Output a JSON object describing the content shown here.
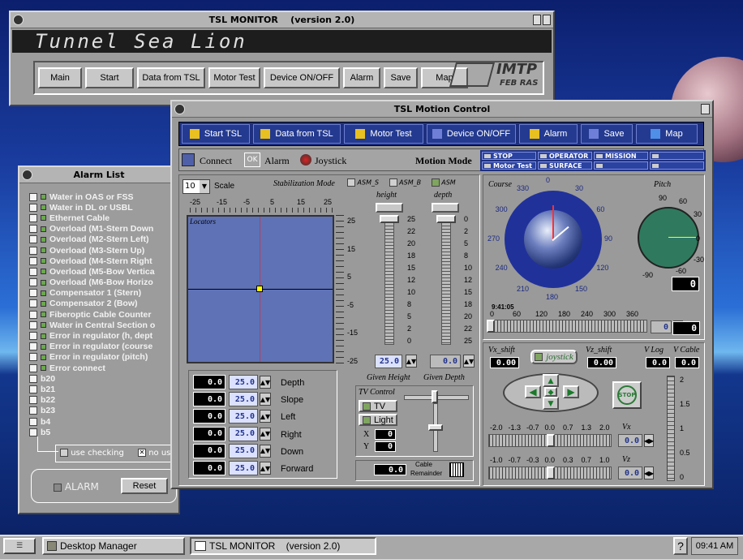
{
  "monitor": {
    "title": "TSL MONITOR    (version 2.0)",
    "app_name": "Tunnel Sea Lion",
    "buttons": [
      "Main",
      "Start",
      "Data from TSL",
      "Motor Test",
      "Device ON/OFF",
      "Alarm",
      "Save",
      "Map"
    ],
    "logo_text": "IMTP",
    "logo_sub": "FEB RAS"
  },
  "alarm": {
    "title": "Alarm List",
    "items": [
      "Water in OAS  or FSS",
      "Water in DL or USBL",
      "Ethernet Cable",
      "Overload (M1-Stern Down",
      "Overload (M2-Stern Left)",
      "Overload (M3-Stern Up)",
      "Overload (M4-Stern Right",
      "Overload (M5-Bow Vertica",
      "Overload (M6-Bow Horizo",
      "Compensator 1 (Stern)",
      "Compensator 2 (Bow)",
      "Fiberoptic Cable Counter",
      "Water in Central Section o",
      "Error in regulator (h, dept",
      "Error in regulator (course",
      "Error in regulator (pitch)",
      "Error connect",
      "b20",
      "b21",
      "b22",
      "b23",
      "b4",
      "b5"
    ],
    "use_checking": "use checking",
    "no_use": "no us",
    "alarm_label": "ALARM",
    "reset": "Reset"
  },
  "motion": {
    "title": "TSL Motion Control",
    "toolbar": [
      "Start TSL",
      "Data from TSL",
      "Motor Test",
      "Device ON/OFF",
      "Alarm",
      "Save",
      "Map"
    ],
    "connect": "Connect",
    "ok": "OK",
    "alarm": "Alarm",
    "joystick": "Joystick",
    "motion_mode": "Motion Mode",
    "modes": [
      "STOP",
      "OPERATOR",
      "MISSION",
      "",
      "Motor Test",
      "SURFACE",
      "",
      ""
    ],
    "scale_val": "10",
    "scale": "Scale",
    "stab_mode": "Stabilization Mode",
    "asm_s": "ASM_S",
    "asm_b": "ASM_B",
    "asm": "ASM",
    "height": "height",
    "depth": "depth",
    "locators": "Locators",
    "x_ticks": [
      "-25",
      "-15",
      "-5",
      "5",
      "15",
      "25"
    ],
    "y_ticks": [
      "25",
      "15",
      "5",
      "-5",
      "-15",
      "-25"
    ],
    "height_ticks": [
      "25",
      "22",
      "20",
      "18",
      "15",
      "12",
      "10",
      "8",
      "5",
      "2",
      "0"
    ],
    "depth_ticks": [
      "0",
      "2",
      "5",
      "8",
      "10",
      "12",
      "15",
      "18",
      "20",
      "22",
      "25"
    ],
    "given_height_val": "25.0",
    "given_depth_val": "0.0",
    "given_height": "Given Height",
    "given_depth": "Given Depth",
    "params": [
      {
        "a": "0.0",
        "b": "25.0",
        "label": "Depth"
      },
      {
        "a": "0.0",
        "b": "25.0",
        "label": "Slope"
      },
      {
        "a": "0.0",
        "b": "25.0",
        "label": "Left"
      },
      {
        "a": "0.0",
        "b": "25.0",
        "label": "Right"
      },
      {
        "a": "0.0",
        "b": "25.0",
        "label": "Down"
      },
      {
        "a": "0.0",
        "b": "25.0",
        "label": "Forward"
      }
    ],
    "tv_control": "TV Control",
    "tv": "TV",
    "light": "Light",
    "x": "X",
    "y": "Y",
    "x_val": "0",
    "y_val": "0",
    "cable_val": "0.0",
    "cable": "Cable",
    "remainder": "Remainder",
    "course": "Course",
    "pitch": "Pitch",
    "course_ticks": [
      "330",
      "0",
      "30",
      "60",
      "90",
      "120",
      "150",
      "180",
      "210",
      "240",
      "270",
      "300"
    ],
    "pitch_ticks": [
      "90",
      "60",
      "30",
      "0",
      "-30",
      "-60",
      "-90"
    ],
    "pitch_val": "0",
    "time": "9:41:05",
    "course_scale": [
      "0",
      "60",
      "120",
      "180",
      "240",
      "300",
      "360"
    ],
    "course_input": "0",
    "course_val": "0",
    "vx_shift": "Vx_shift",
    "vx_shift_val": "0.00",
    "joystick_btn": "joystick",
    "vz_shift": "Vz_shift",
    "vz_shift_val": "0.00",
    "v_log": "V Log",
    "v_log_val": "0.0",
    "v_cable": "V Cable",
    "v_cable_val": "0.0",
    "stop": "STOP",
    "vx_ticks": [
      "-2.0",
      "-1.3",
      "-0.7",
      "0.0",
      "0.7",
      "1.3",
      "2.0"
    ],
    "vx": "Vx",
    "vx_val": "0.0",
    "vz_ticks": [
      "-1.0",
      "-0.7",
      "-0.3",
      "0.0",
      "0.3",
      "0.7",
      "1.0"
    ],
    "vz": "Vz",
    "vz_val": "0.0",
    "vert_ticks": [
      "2",
      "1.5",
      "1",
      "0.5",
      "0"
    ]
  },
  "taskbar": {
    "desktop": "Desktop Manager",
    "task": "TSL MONITOR    (version 2.0)",
    "time": "09:41 AM",
    "help": "?"
  }
}
